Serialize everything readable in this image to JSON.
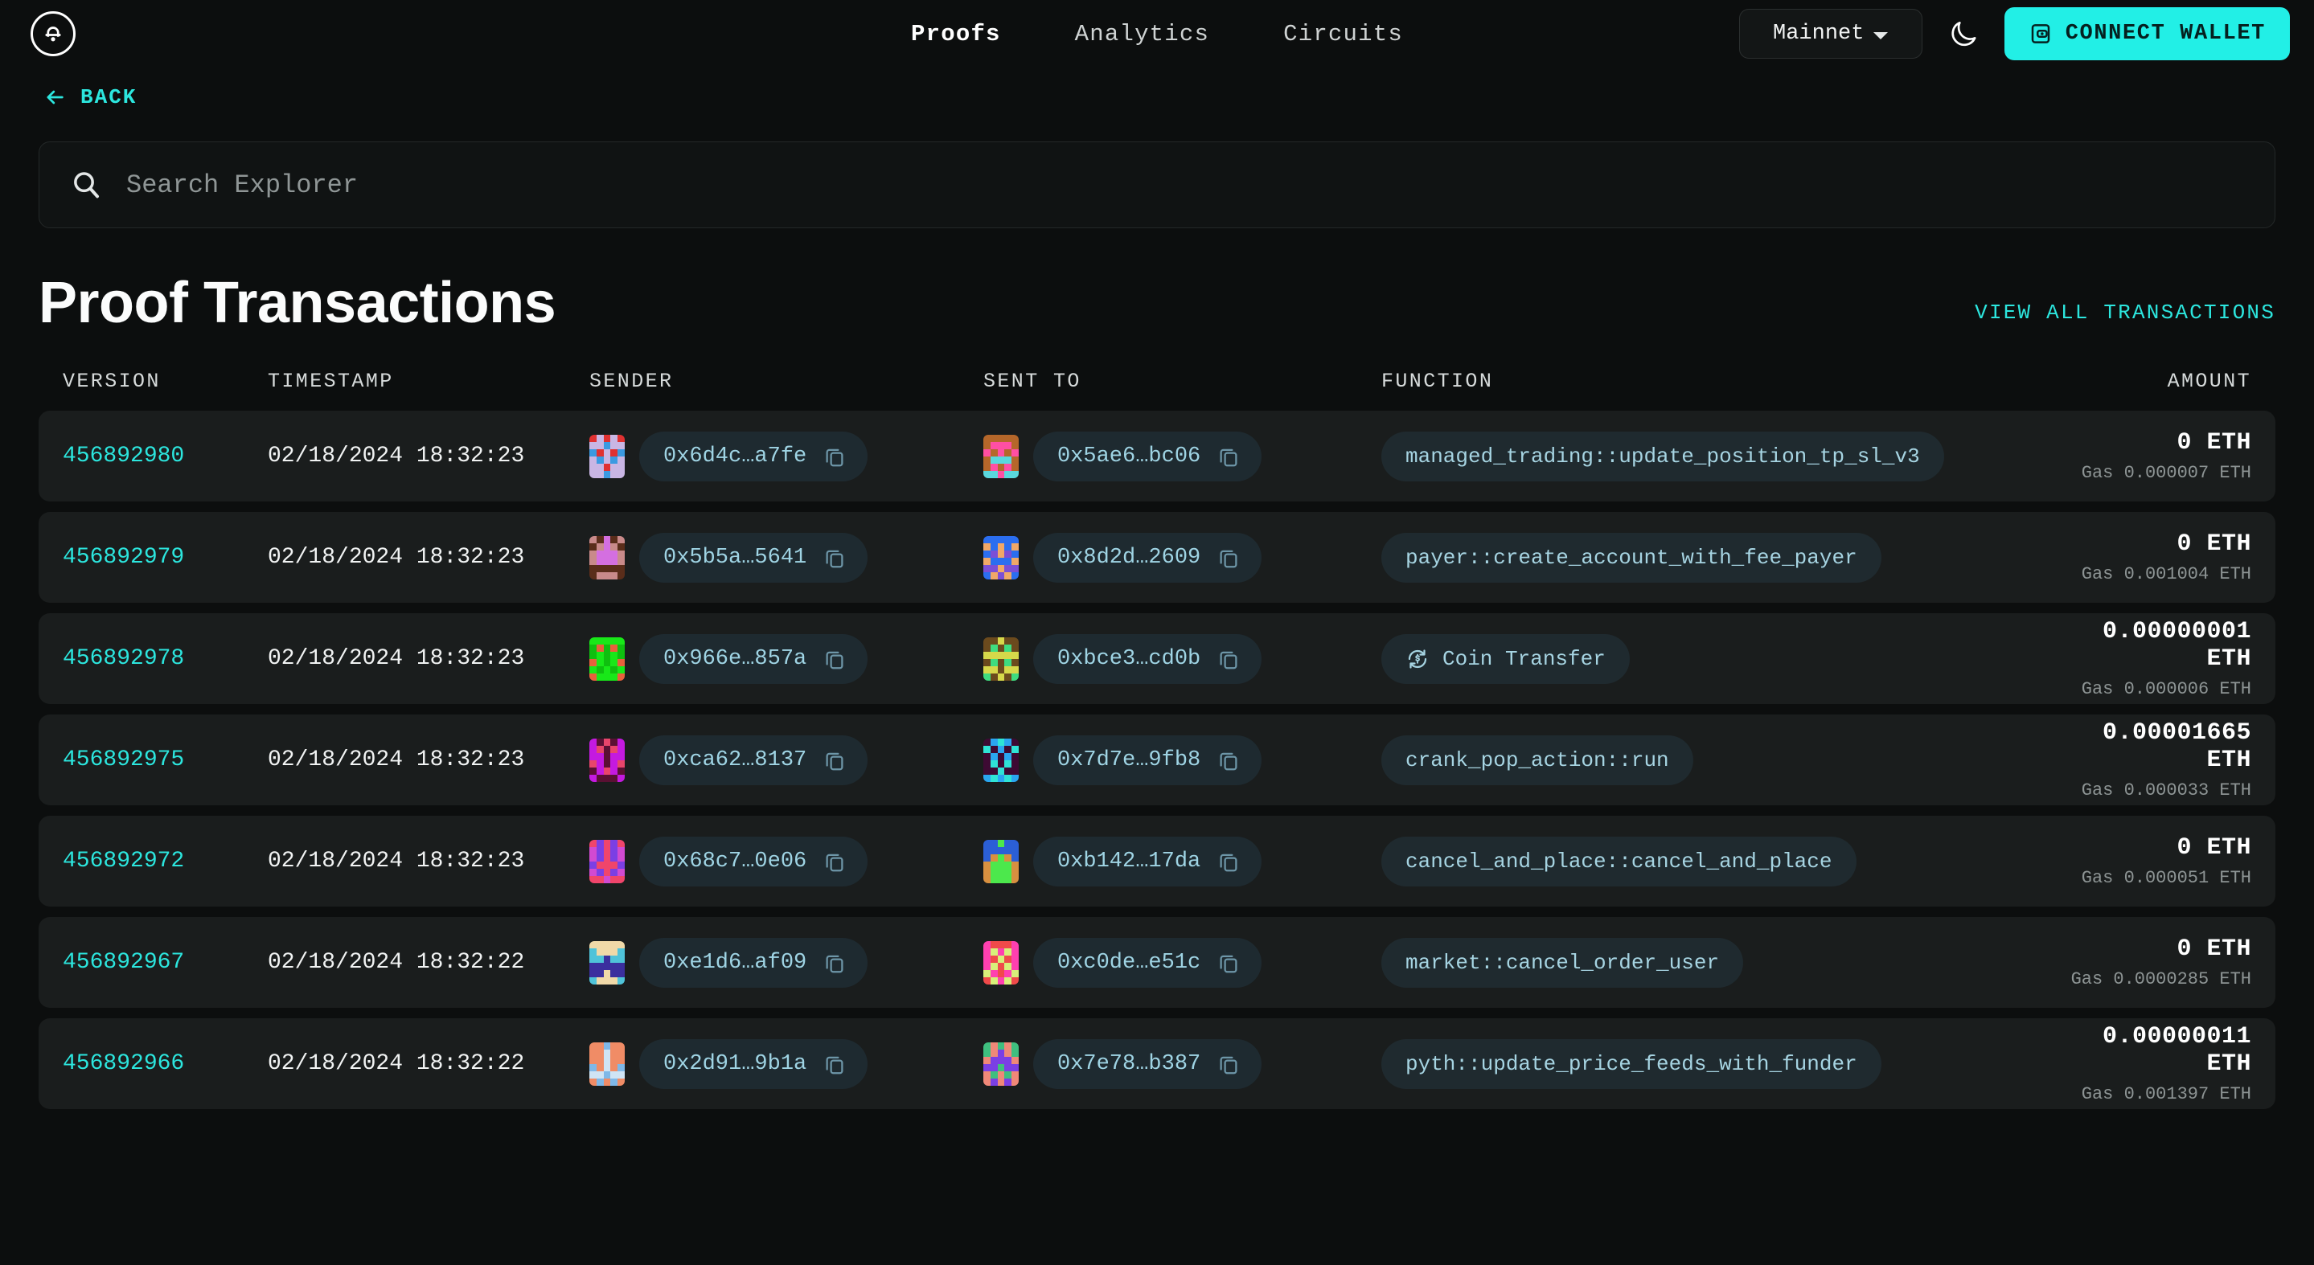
{
  "header": {
    "logo_name": "aptos-logo",
    "nav": [
      {
        "label": "Proofs",
        "active": true
      },
      {
        "label": "Analytics",
        "active": false
      },
      {
        "label": "Circuits",
        "active": false
      }
    ],
    "network": "Mainnet",
    "theme_toggle_icon": "moon-icon",
    "connect_label": "CONNECT WALLET",
    "accent": "#22efe6"
  },
  "back": {
    "label": "BACK",
    "icon": "arrow-left-icon"
  },
  "search": {
    "placeholder": "Search Explorer",
    "value": "",
    "icon": "search-icon"
  },
  "main": {
    "title": "Proof Transactions",
    "view_all_label": "VIEW ALL TRANSACTIONS"
  },
  "table": {
    "columns": [
      "VERSION",
      "TIMESTAMP",
      "SENDER",
      "SENT TO",
      "FUNCTION",
      "AMOUNT"
    ],
    "rows": [
      {
        "version": "456892980",
        "timestamp": "02/18/2024 18:32:23",
        "sender": "0x6d4c…a7fe",
        "sender_colors": [
          "#c9b6e4",
          "#e03131",
          "#3b9ae1"
        ],
        "sent_to": "0x5ae6…bc06",
        "sent_to_colors": [
          "#ff4fa3",
          "#5ad8dd",
          "#b5672a"
        ],
        "function": "managed_trading::update_position_tp_sl_v3",
        "function_icon": "",
        "amount": "0 ETH",
        "gas": "Gas 0.000007 ETH"
      },
      {
        "version": "456892979",
        "timestamp": "02/18/2024 18:32:23",
        "sender": "0x5b5a…5641",
        "sender_colors": [
          "#d46fe0",
          "#5a2d1a",
          "#c98a8a"
        ],
        "sent_to": "0x8d2d…2609",
        "sent_to_colors": [
          "#f0a868",
          "#2b6ef0",
          "#7b4fd6"
        ],
        "function": "payer::create_account_with_fee_payer",
        "function_icon": "",
        "amount": "0 ETH",
        "gas": "Gas 0.001004 ETH"
      },
      {
        "version": "456892978",
        "timestamp": "02/18/2024 18:32:23",
        "sender": "0x966e…857a",
        "sender_colors": [
          "#18e818",
          "#e8603c",
          "#0fbf0f"
        ],
        "sent_to": "0xbce3…cd0b",
        "sent_to_colors": [
          "#3fdc7f",
          "#d6d84a",
          "#6b4a1d"
        ],
        "function": "Coin Transfer",
        "function_icon": "coin-transfer-icon",
        "amount": "0.00000001 ETH",
        "gas": "Gas 0.000006 ETH"
      },
      {
        "version": "456892975",
        "timestamp": "02/18/2024 18:32:23",
        "sender": "0xca62…8137",
        "sender_colors": [
          "#c41ae0",
          "#e8456b",
          "#5a1033"
        ],
        "sent_to": "0x7d7e…9fb8",
        "sent_to_colors": [
          "#2aa6f0",
          "#2fe3d6",
          "#3d0a33"
        ],
        "function": "crank_pop_action::run",
        "function_icon": "",
        "amount": "0.00001665 ETH",
        "gas": "Gas 0.000033 ETH"
      },
      {
        "version": "456892972",
        "timestamp": "02/18/2024 18:32:23",
        "sender": "0x68c7…0e06",
        "sender_colors": [
          "#7b3fe4",
          "#f0456b",
          "#d14ad1"
        ],
        "sent_to": "0xb142…17da",
        "sent_to_colors": [
          "#4ce84c",
          "#2b5fd6",
          "#d89040"
        ],
        "function": "cancel_and_place::cancel_and_place",
        "function_icon": "",
        "amount": "0 ETH",
        "gas": "Gas 0.000051 ETH"
      },
      {
        "version": "456892967",
        "timestamp": "02/18/2024 18:32:22",
        "sender": "0xe1d6…af09",
        "sender_colors": [
          "#3b2f9e",
          "#4fc3d9",
          "#f0d9a8"
        ],
        "sent_to": "0xc0de…e51c",
        "sent_to_colors": [
          "#f04a4a",
          "#ff40b0",
          "#d8f07a"
        ],
        "function": "market::cancel_order_user",
        "function_icon": "",
        "amount": "0 ETH",
        "gas": "Gas 0.0000285 ETH"
      },
      {
        "version": "456892966",
        "timestamp": "02/18/2024 18:32:22",
        "sender": "0x2d91…9b1a",
        "sender_colors": [
          "#f08c66",
          "#cfe4f5",
          "#7fb8e8"
        ],
        "sent_to": "0x7e78…b387",
        "sent_to_colors": [
          "#f08878",
          "#7b3fe4",
          "#3fbf7f"
        ],
        "function": "pyth::update_price_feeds_with_funder",
        "function_icon": "",
        "amount": "0.00000011 ETH",
        "gas": "Gas 0.001397 ETH"
      }
    ]
  }
}
